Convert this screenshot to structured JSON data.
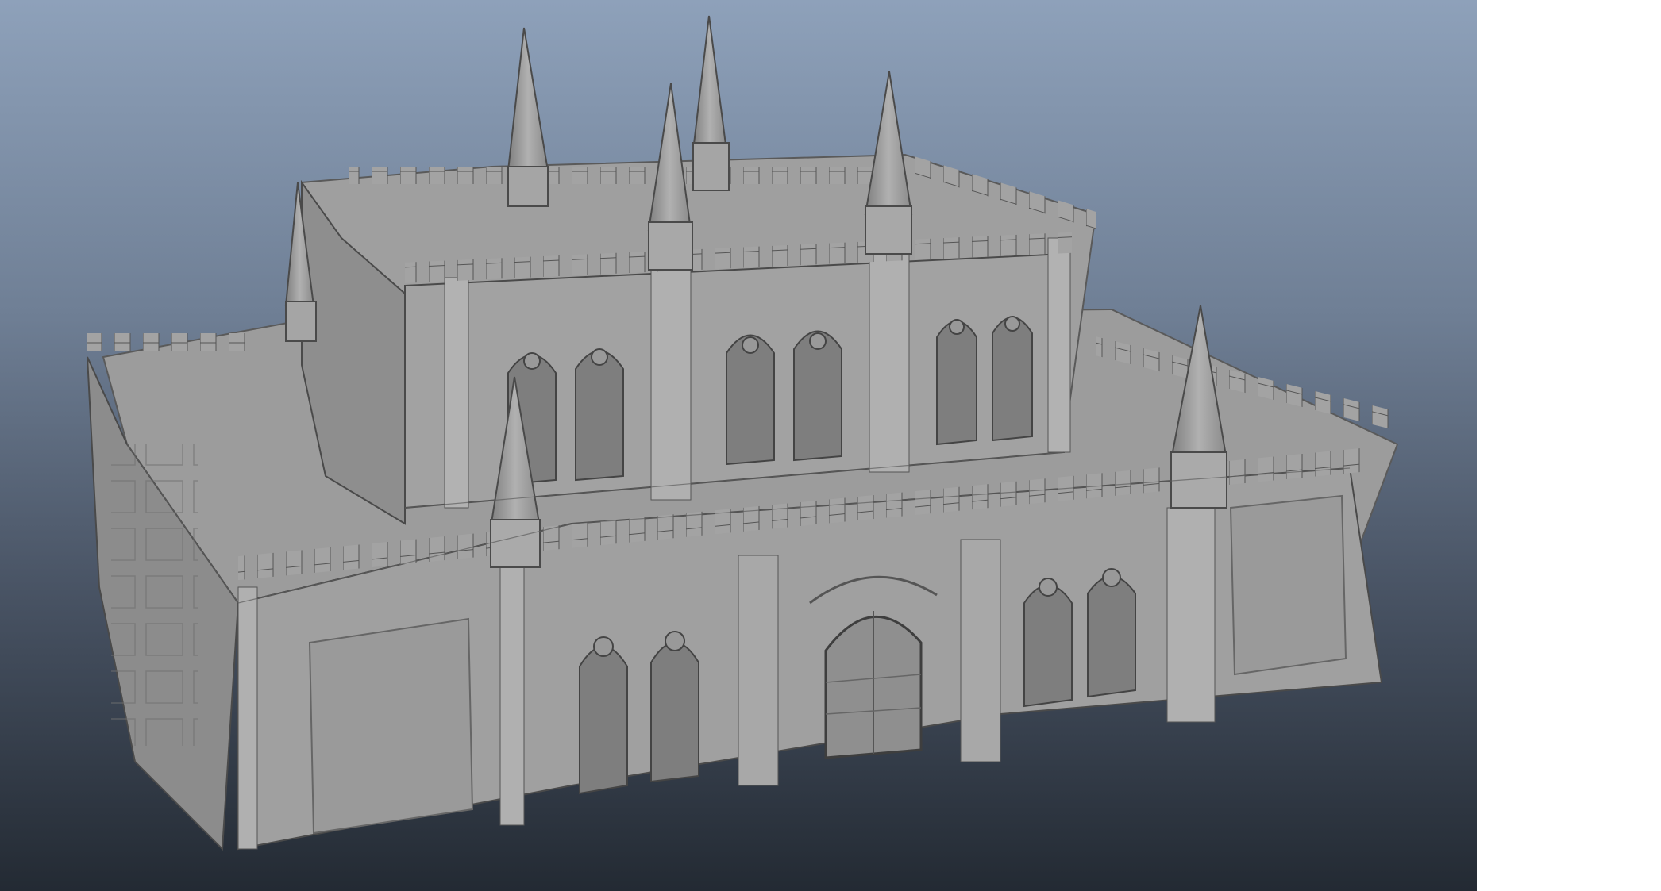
{
  "viewport": {
    "background_top": "#8ea1ba",
    "background_bottom": "#232a33",
    "model_color": "#9a9a9a",
    "model_shadow_color": "#6e6e6e",
    "model_highlight_color": "#b4b4b4",
    "edge_color": "#4a4a4a"
  },
  "model": {
    "description_icon": "gothic-cathedral-3d-model",
    "spire_count": 7,
    "tiers": 2
  }
}
